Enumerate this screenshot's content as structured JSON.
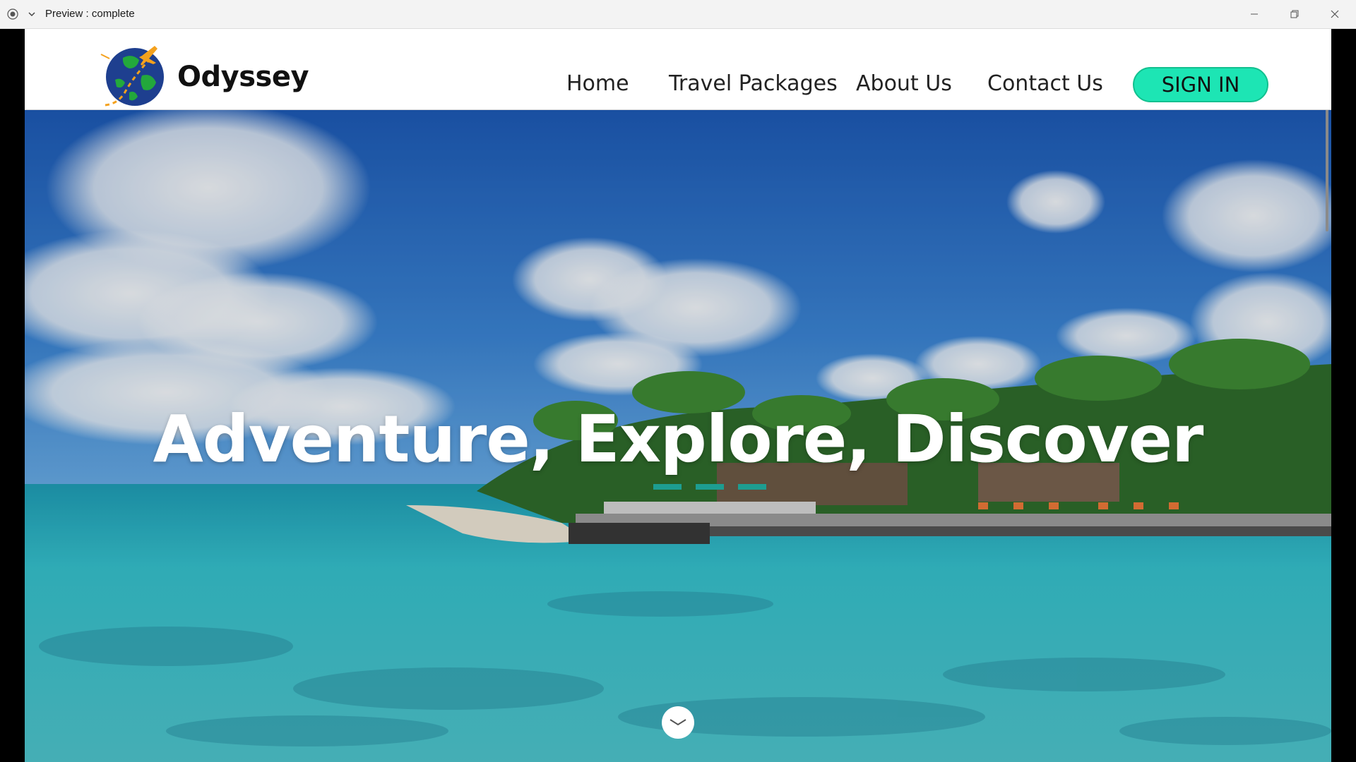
{
  "window": {
    "title": "Preview : complete"
  },
  "header": {
    "brand": "Odyssey",
    "nav": {
      "home": "Home",
      "packages": "Travel Packages",
      "about": "About Us",
      "contact": "Contact Us"
    },
    "signin_label": "SIGN IN"
  },
  "hero": {
    "headline": "Adventure, Explore, Discover"
  },
  "colors": {
    "accent": "#1de5b4",
    "globe": "#1e3f8f",
    "land": "#23a83c",
    "plane": "#f4a11d"
  },
  "icons": {
    "logo": "globe-with-airplane-icon",
    "scroll": "chevron-down-icon"
  }
}
